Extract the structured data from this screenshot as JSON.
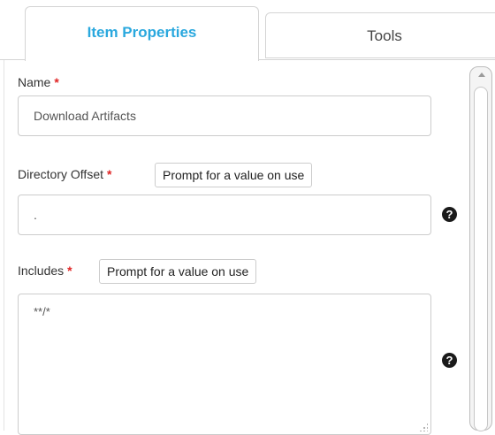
{
  "tabs": {
    "active_label": "Item Properties",
    "inactive_label": "Tools"
  },
  "form": {
    "name": {
      "label": "Name",
      "required_mark": "*",
      "value": "Download Artifacts"
    },
    "directory_offset": {
      "label": "Directory Offset",
      "required_mark": "*",
      "prompt_button": "Prompt for a value on use",
      "value": ".",
      "help": "?"
    },
    "includes": {
      "label": "Includes",
      "required_mark": "*",
      "prompt_button": "Prompt for a value on use",
      "value": "**/*",
      "help": "?"
    }
  },
  "colors": {
    "accent": "#2aa8de",
    "required": "#e02424",
    "border": "#cccccc"
  },
  "icons": {
    "help": "question-circle-icon",
    "scroll_up": "arrow-up-icon",
    "resize": "resize-grip-icon"
  }
}
